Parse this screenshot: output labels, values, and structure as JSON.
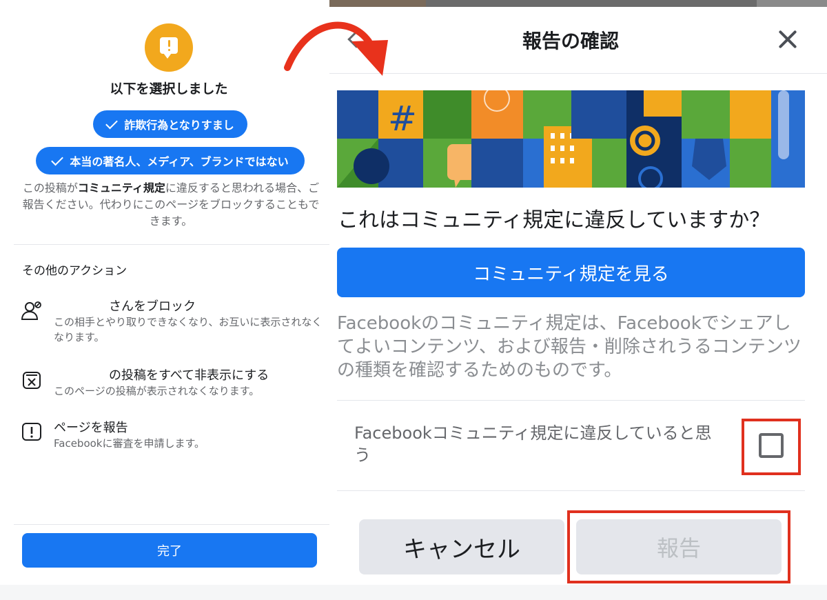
{
  "left_panel": {
    "selected_title": "以下を選択しました",
    "selected_tags": [
      "詐欺行為となりすまし",
      "本当の著名人、メディア、ブランドではない"
    ],
    "description_pre": "この投稿が",
    "description_bold": "コミュニティ規定",
    "description_post": "に違反すると思われる場合、ご報告ください。代わりにこのページをブロックすることもできます。",
    "other_actions_title": "その他のアクション",
    "actions": [
      {
        "icon": "person-block-icon",
        "title": "さんをブロック",
        "subtitle": "この相手とやり取りできなくなり、お互いに表示されなくなります。"
      },
      {
        "icon": "hide-posts-icon",
        "title": "の投稿をすべて非表示にする",
        "subtitle": "このページの投稿が表示されなくなります。"
      },
      {
        "icon": "report-icon",
        "title": "ページを報告",
        "subtitle": "Facebookに審査を申請します。"
      }
    ],
    "done_label": "完了"
  },
  "right_panel": {
    "title": "報告の確認",
    "question": "これはコミュニティ規定に違反していますか？",
    "view_button_label": "コミュニティ規定を見る",
    "info_text": "Facebookのコミュニティ規定は、Facebookでシェアしてよいコンテンツ、および報告・削除されうるコンテンツの種類を確認するためのものです。",
    "checkbox_label": "Facebookコミュニティ規定に違反していると思う",
    "checkbox_checked": false,
    "cancel_label": "キャンセル",
    "report_label": "報告"
  },
  "colors": {
    "accent": "#1877f2",
    "alert": "#f2a81d",
    "highlight": "#e0301e",
    "arrow": "#e8321c"
  }
}
